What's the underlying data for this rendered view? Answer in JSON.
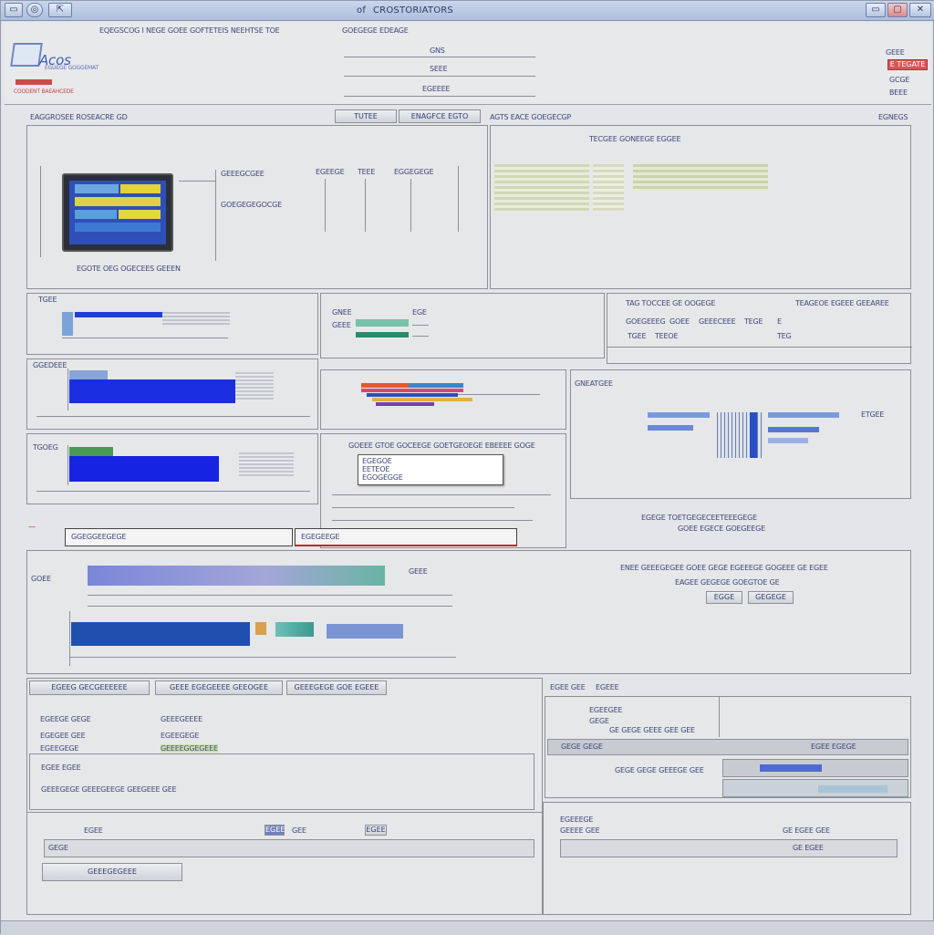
{
  "window": {
    "title": "CROSTORIATORS",
    "title_prefix": "of",
    "controls": {
      "minimize": "▭",
      "maximize": "▢",
      "close": "✕"
    }
  },
  "header": {
    "logo_text": "Acos",
    "logo_sub": "EGUEGE GOGGEMAT",
    "logo_sub2": "COODENT BAEAHCEDE",
    "menu_left": "EQEGSCOG I NEGE GOEE GOFTETEIS NEEHTSE TOE",
    "menu_right": "GOEGEGE EDEAGE",
    "center_fields": [
      "GNS",
      "SEEE",
      "EGEEEE"
    ],
    "right_labels": [
      "GEEE",
      "E TEGATE",
      "GCGE",
      "BEEE"
    ]
  },
  "top_section": {
    "left_title": "EAGGROSEE ROSEACRE GD",
    "tab1": "TUTEE",
    "tab2": "ENAGFCE EGTO",
    "right_title": "AGTS EACE GOEGECGP",
    "right_corner": "EGNEGS",
    "device_caption": "EGOTE OEG OGECEES GEEEN",
    "col_labels": [
      "GEEEGCGEE",
      "EGEEGE",
      "TEEE",
      "EGGEGEGE"
    ],
    "side_label": "GOEGEGEGOCGE",
    "right_header": "TECGEE GONEEGE EGGEE"
  },
  "mid_section": {
    "p1_label": "TGEE",
    "p2_labels": [
      "GNEE",
      "GEEE",
      "EGE"
    ],
    "p3_title": "TAG TOCCEE GE OOGEGE",
    "p3_title2": "TEAGEOE EGEEE GEEAREE",
    "p3_row": [
      "GOEGEEEG",
      "GOEE",
      "GEEECEEE",
      "TEGE",
      "E"
    ],
    "p3_row2": [
      "TGEE",
      "TEEOE",
      "TEG"
    ],
    "p4_label": "GGEDEEE",
    "p6_label": "GNEATGEE",
    "p6_right": "ETGEE",
    "p9_header": "GOEEE GTOE GOCEEGE GOETGEOEGE EBEEEE GOGE",
    "popup_lines": [
      "EGEGOE",
      "EETEOE",
      "EGOGEGGE"
    ],
    "small_label": "TGOEG",
    "wide_bar_left": "GGEGGEEGEGE",
    "wide_bar_right": "EGEGEEGE",
    "right_lines": [
      "EGEGE TOETGEGECEETEEEGEGE",
      "GOEE EGECE GOEGEEGE"
    ]
  },
  "lower_section": {
    "title": "ENEE GEEEGEGEE GOEE GEGE EGEEEGE GOGEEE GE EGEE",
    "sub": "EAGEE GEGEGE GOEGTOE GE",
    "buttons": [
      "EGGE",
      "GEGEGE"
    ],
    "chart_label": "GOEE",
    "chart_label2": "GEEE"
  },
  "bottom_left": {
    "tabs": [
      "EGEEG GECGEEEEEE",
      "GEEE EGEGEEEE GEEOGEE",
      "GEEEGEGE GOE EGEEE"
    ],
    "rows": [
      [
        "EGEEGE GEGE",
        "GEEEGEEEE"
      ],
      [
        "EGEGEE GEE",
        "EGEEGEGE"
      ],
      [
        "EGEEGEGE",
        "GEEEEGGEGEEE"
      ]
    ],
    "subhead": "EGEE EGEE",
    "subrow": "GEEEGEGE GEEEGEEGE GEEGEEE GEE",
    "footer_labels": [
      "EGEE",
      "EGEE",
      "GEE"
    ],
    "footer_field": "GEGE",
    "footer_field2": "EGEE",
    "footer_button": "GEEEGEGEEE"
  },
  "bottom_right": {
    "title": "EGEE GEE",
    "title2": "EGEEE",
    "rows": [
      "EGEEGEE",
      "GEGE",
      "GE GEGE GEEE GEE GEE"
    ],
    "bar_label": "GEGE GEGE",
    "bar_label2": "EGEE EGEGE",
    "sub1": "GEGE GEGE GEEEGE GEE",
    "footer_labels": [
      "EGEEEGE",
      "GEEEE GEE"
    ],
    "footer_right": "GE EGEE GEE",
    "footer_field": "GE EGEE"
  }
}
